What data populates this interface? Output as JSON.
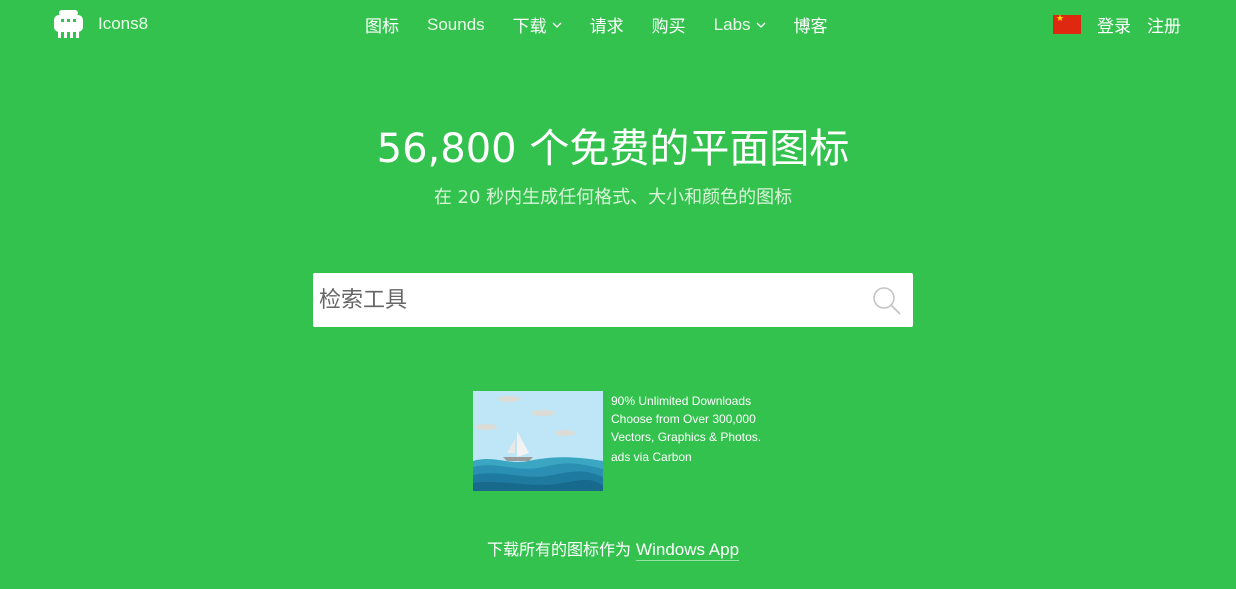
{
  "brand": {
    "name": "Icons8",
    "logo_icon": "icons8-robot-logo"
  },
  "nav": {
    "items": [
      {
        "label": "图标",
        "dropdown": false
      },
      {
        "label": "Sounds",
        "dropdown": false
      },
      {
        "label": "下载",
        "dropdown": true
      },
      {
        "label": "请求",
        "dropdown": false
      },
      {
        "label": "购买",
        "dropdown": false
      },
      {
        "label": "Labs",
        "dropdown": true
      },
      {
        "label": "博客",
        "dropdown": false
      }
    ]
  },
  "header_right": {
    "flag_icon": "china-flag-icon",
    "login": "登录",
    "register": "注册"
  },
  "hero": {
    "title": "56,800 个免费的平面图标",
    "subtitle": "在 20 秒内生成任何格式、大小和颜色的图标"
  },
  "search": {
    "placeholder": "检索工具",
    "value": "",
    "icon": "search-icon"
  },
  "ad": {
    "lines": [
      "90% Unlimited Downloads",
      "Choose from Over 300,000",
      "Vectors, Graphics & Photos."
    ],
    "via": "ads via Carbon"
  },
  "download": {
    "prefix": "下载所有的图标作为",
    "link": "Windows App"
  },
  "colors": {
    "background": "#34c24f",
    "text": "#ffffff",
    "subtitle": "#d8f5d8"
  }
}
